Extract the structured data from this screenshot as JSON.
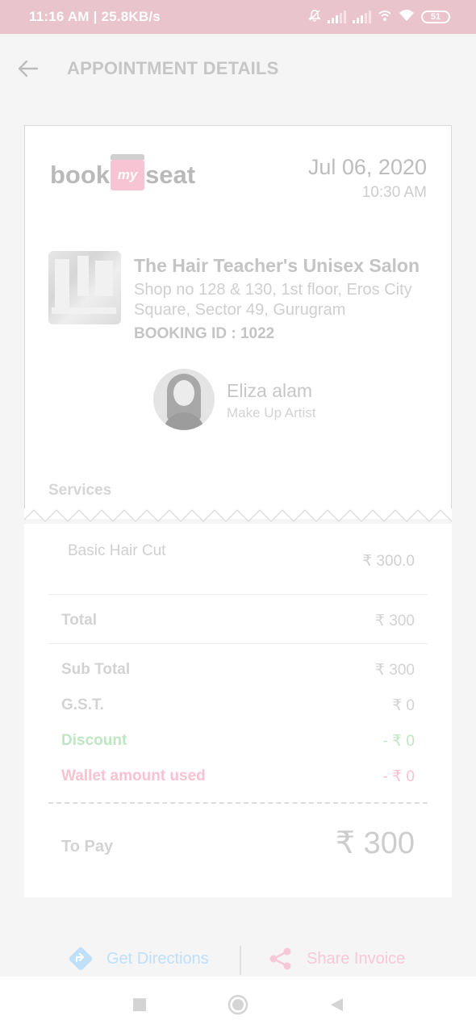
{
  "status_bar": {
    "time_speed": "11:16 AM | 25.8KB/s",
    "battery": "51"
  },
  "app_bar": {
    "title": "APPOINTMENT DETAILS"
  },
  "logo": {
    "part1": "book",
    "part2": "my",
    "part3": "seat"
  },
  "appointment": {
    "date": "Jul 06, 2020",
    "time": "10:30 AM"
  },
  "salon": {
    "name": "The Hair Teacher's Unisex Salon",
    "address": "Shop no 128 & 130, 1st floor, Eros City Square, Sector 49, Gurugram",
    "booking_id": "BOOKING ID : 1022"
  },
  "artist": {
    "name": "Eliza alam",
    "role": "Make Up Artist"
  },
  "services": {
    "heading": "Services",
    "items": [
      {
        "name": "Basic Hair Cut",
        "price": "₹ 300.0"
      }
    ]
  },
  "bill": {
    "total_label": "Total",
    "total_value": "₹ 300",
    "subtotal_label": "Sub Total",
    "subtotal_value": "₹ 300",
    "gst_label": "G.S.T.",
    "gst_value": "₹ 0",
    "discount_label": "Discount",
    "discount_value": "- ₹ 0",
    "wallet_label": "Wallet amount used",
    "wallet_value": "- ₹ 0",
    "to_pay_label": "To Pay",
    "to_pay_value": "₹ 300"
  },
  "colors": {
    "discount": "#bfe8c2",
    "wallet": "#f8c2d2",
    "directions": "#bfe0f8",
    "share": "#f9c8d6"
  },
  "actions": {
    "directions_label": "Get Directions",
    "share_label": "Share Invoice"
  }
}
